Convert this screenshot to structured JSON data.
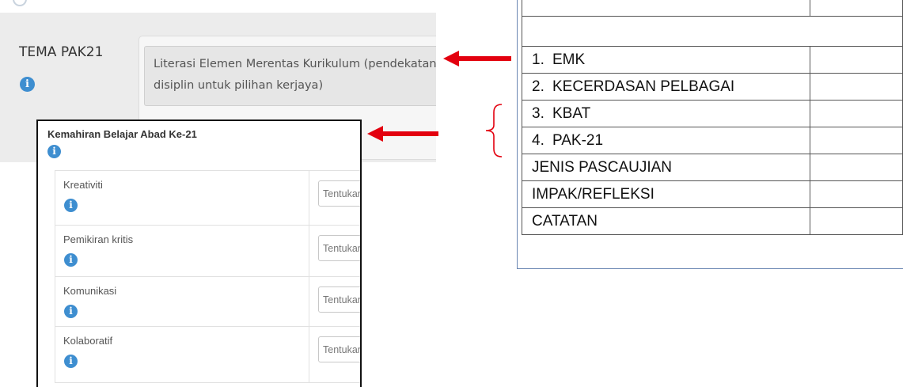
{
  "tema": {
    "label": "TEMA PAK21",
    "value": "Literasi Elemen Merentas Kurikulum (pendekatan pelbagai disiplin untuk pilihan kerjaya)"
  },
  "kemahiran": {
    "title": "Kemahiran Belajar Abad Ke-21",
    "rows": [
      {
        "label": "Kreativiti",
        "placeholder": "Tentukan"
      },
      {
        "label": "Pemikiran kritis",
        "placeholder": "Tentukan"
      },
      {
        "label": "Komunikasi",
        "placeholder": "Tentukan"
      },
      {
        "label": "Kolaboratif",
        "placeholder": "Tentukan"
      }
    ]
  },
  "report_table": {
    "rows": [
      {
        "num": "",
        "label": ""
      },
      {
        "num": "",
        "label": ""
      },
      {
        "num": "1.",
        "label": "EMK"
      },
      {
        "num": "2.",
        "label": "KECERDASAN PELBAGAI"
      },
      {
        "num": "3.",
        "label": "KBAT"
      },
      {
        "num": "4.",
        "label": "PAK-21"
      },
      {
        "num": "",
        "label": "JENIS PASCAUJIAN"
      },
      {
        "num": "",
        "label": "IMPAK/REFLEKSI"
      },
      {
        "num": "",
        "label": "CATATAN"
      }
    ]
  },
  "icons": {
    "info": "info-icon",
    "arrow": "arrow-left-icon",
    "brace": "left-brace-icon"
  },
  "colors": {
    "arrow": "#e3000f",
    "info": "#3e8ed0"
  }
}
